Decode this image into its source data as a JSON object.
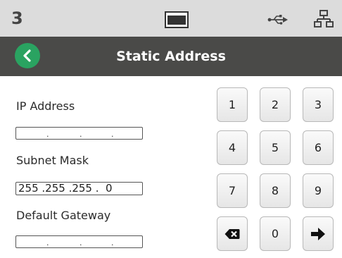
{
  "status": {
    "count": "3",
    "icons": [
      "display-icon",
      "usb-icon",
      "network-icon"
    ]
  },
  "header": {
    "back_icon": "back-chevron-icon",
    "title": "Static Address"
  },
  "form": {
    "ip_label": "IP Address",
    "ip_value": "",
    "subnet_label": "Subnet Mask",
    "subnet_value": "255 .255 .255 .  0",
    "gateway_label": "Default Gateway",
    "gateway_value": ""
  },
  "keypad": {
    "keys": [
      "1",
      "2",
      "3",
      "4",
      "5",
      "6",
      "7",
      "8",
      "9",
      "backspace",
      "0",
      "enter"
    ],
    "k1": "1",
    "k2": "2",
    "k3": "3",
    "k4": "4",
    "k5": "5",
    "k6": "6",
    "k7": "7",
    "k8": "8",
    "k9": "9",
    "k0": "0",
    "backspace_icon": "backspace-icon",
    "enter_icon": "arrow-right-icon"
  },
  "colors": {
    "accent": "#2aa361",
    "header_bg": "#4a4a48",
    "status_bg": "#dcdcdc"
  }
}
